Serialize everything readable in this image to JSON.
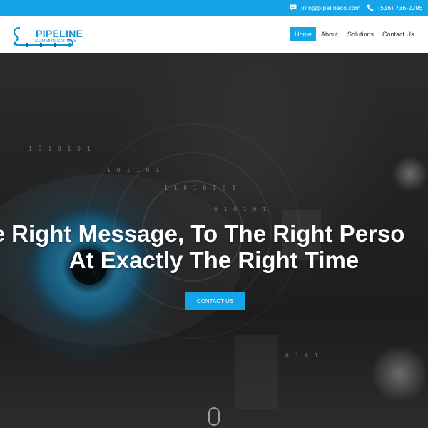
{
  "topbar": {
    "email": "info@pipelineco.com",
    "phone": "(516) 736-2295",
    "email_icon": "chat-icon",
    "phone_icon": "phone-icon"
  },
  "header": {
    "logo_title": "PIPELINE",
    "logo_subtitle": "COMMUNICATIONS",
    "nav": [
      {
        "label": "Home",
        "active": true
      },
      {
        "label": "About",
        "active": false
      },
      {
        "label": "Solutions",
        "active": false
      },
      {
        "label": "Contact Us",
        "active": false
      }
    ]
  },
  "hero": {
    "headline_line1": "e Right Message, To The Right Perso",
    "headline_line2": "At Exactly The Right Time",
    "cta_label": "CONTACT US",
    "scroll_icon": "mouse-scroll-icon"
  },
  "colors": {
    "accent": "#14a4e7",
    "header_bg": "#ffffff",
    "text_dark": "#333333"
  }
}
